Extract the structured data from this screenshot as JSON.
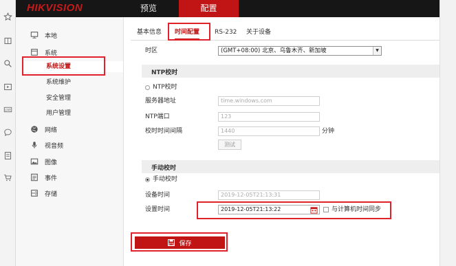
{
  "header": {
    "logo": "HIKVISION",
    "nav_preview": "预览",
    "nav_config": "配置"
  },
  "sidebar_icons": [
    "star-icon",
    "book-icon",
    "search-icon",
    "video-icon",
    "live-icon",
    "chat-icon",
    "note-icon",
    "cart-icon"
  ],
  "menu": {
    "local": "本地",
    "system": "系统",
    "system_settings": "系统设置",
    "system_maintenance": "系统维护",
    "security_management": "安全管理",
    "user_management": "用户管理",
    "network": "网络",
    "video_audio": "视音频",
    "image": "图像",
    "event": "事件",
    "storage": "存储"
  },
  "tabs": {
    "basic_info": "基本信息",
    "time_config": "时间配置",
    "rs232": "RS-232",
    "about": "关于设备"
  },
  "form": {
    "timezone_label": "时区",
    "timezone_value": "(GMT+08:00) 北京、乌鲁木齐、新加坡",
    "ntp_section": "NTP校时",
    "ntp_radio": "NTP校时",
    "server_label": "服务器地址",
    "server_value": "time.windows.com",
    "port_label": "NTP端口",
    "port_value": "123",
    "interval_label": "校时时间间隔",
    "interval_value": "1440",
    "interval_unit": "分钟",
    "test_button": "测试",
    "manual_section": "手动校时",
    "manual_radio": "手动校时",
    "device_time_label": "设备时间",
    "device_time_value": "2019-12-05T21:13:31",
    "set_time_label": "设置时间",
    "set_time_value": "2019-12-05T21:13:22",
    "sync_pc_label": "与计算机时间同步",
    "save_button": "保存"
  },
  "colors": {
    "brand_red": "#c11515",
    "highlight_red": "#e0202a",
    "header_bg": "#161616"
  }
}
